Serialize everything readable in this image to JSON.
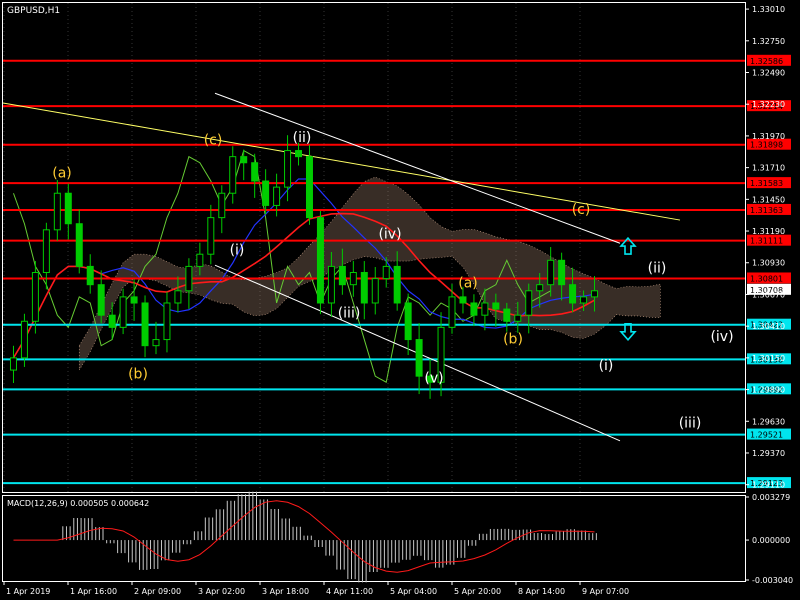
{
  "chart_data": {
    "type": "candlestick",
    "symbol": "GBPUSD",
    "timeframe": "H1",
    "title": "GBPUSD,H1",
    "price_range": [
      1.2905,
      1.3306
    ],
    "price_ticks": [
      "1.33010",
      "1.32750",
      "1.32490",
      "1.32230",
      "1.31970",
      "1.31710",
      "1.31450",
      "1.31190",
      "1.30930",
      "1.30670",
      "1.30410",
      "1.30150",
      "1.29890",
      "1.29630",
      "1.29370",
      "1.29110"
    ],
    "time_labels": [
      "1 Apr 2019",
      "1 Apr 16:00",
      "2 Apr 09:00",
      "3 Apr 02:00",
      "3 Apr 18:00",
      "4 Apr 11:00",
      "5 Apr 04:00",
      "5 Apr 20:00",
      "8 Apr 14:00",
      "9 Apr 07:00"
    ],
    "levels": [
      {
        "value": 1.32586,
        "label": "1.32586",
        "color": "#ff0000"
      },
      {
        "value": 1.32214,
        "label": "1.32214",
        "color": "#ff0000"
      },
      {
        "value": 1.31898,
        "label": "1.31898",
        "color": "#ff0000"
      },
      {
        "value": 1.31583,
        "label": "1.31583",
        "color": "#ff0000"
      },
      {
        "value": 1.31363,
        "label": "1.31363",
        "color": "#ff0000"
      },
      {
        "value": 1.31111,
        "label": "1.31111",
        "color": "#ff0000"
      },
      {
        "value": 1.30801,
        "label": "1.30801",
        "color": "#ff0000"
      },
      {
        "value": 1.30422,
        "label": "1.30422",
        "color": "#00e5ee"
      },
      {
        "value": 1.30138,
        "label": "1.30138",
        "color": "#00e5ee"
      },
      {
        "value": 1.29892,
        "label": "1.29892",
        "color": "#00e5ee"
      },
      {
        "value": 1.29521,
        "label": "1.29521",
        "color": "#00e5ee"
      },
      {
        "value": 1.29123,
        "label": "1.29123",
        "color": "#00e5ee"
      }
    ],
    "current_price": {
      "value": 1.30708,
      "label": "1.30708"
    },
    "close_series": [
      1.3015,
      1.3045,
      1.3085,
      1.312,
      1.315,
      1.3125,
      1.309,
      1.3075,
      1.305,
      1.304,
      1.3065,
      1.306,
      1.3025,
      1.303,
      1.306,
      1.307,
      1.309,
      1.31,
      1.313,
      1.315,
      1.318,
      1.3175,
      1.316,
      1.314,
      1.3155,
      1.3185,
      1.318,
      1.313,
      1.306,
      1.309,
      1.3075,
      1.3085,
      1.306,
      1.308,
      1.309,
      1.306,
      1.303,
      1.3,
      1.2995,
      1.304,
      1.3065,
      1.306,
      1.305,
      1.306,
      1.3055,
      1.3045,
      1.305,
      1.307,
      1.3075,
      1.3095,
      1.3075,
      1.306,
      1.3065,
      1.307
    ],
    "waves": [
      {
        "label": "(a)",
        "price": 1.3167,
        "color": "#ffcc33"
      },
      {
        "label": "(b)",
        "price": 1.3002,
        "color": "#ffcc33"
      },
      {
        "label": "(c)",
        "price": 1.3194,
        "color": "#ffcc33"
      },
      {
        "label": "(ii)",
        "price": 1.3196,
        "color": "#ffffff"
      },
      {
        "label": "(i)",
        "price": 1.3104,
        "color": "#ffffff"
      },
      {
        "label": "(iv)",
        "price": 1.3117,
        "color": "#ffffff"
      },
      {
        "label": "(iii)",
        "price": 1.3052,
        "color": "#ffffff"
      },
      {
        "label": "(v)",
        "price": 1.2999,
        "color": "#ffffff"
      },
      {
        "label": "(a)",
        "price": 1.3077,
        "color": "#ffcc33"
      },
      {
        "label": "(b)",
        "price": 1.3031,
        "color": "#ffcc33"
      },
      {
        "label": "(c)",
        "price": 1.3137,
        "color": "#ffcc33"
      },
      {
        "label": "(ii)",
        "price": 1.3089,
        "color": "#ffffff"
      },
      {
        "label": "(iv)",
        "price": 1.3033,
        "color": "#ffffff"
      },
      {
        "label": "(i)",
        "price": 1.3009,
        "color": "#ffffff"
      },
      {
        "label": "(iii)",
        "price": 1.2962,
        "color": "#ffffff"
      }
    ],
    "macd": {
      "label": "MACD(12,26,9) 0.000505 0.000642",
      "params": "12,26,9",
      "value": 0.000505,
      "signal": 0.000642,
      "ticks": [
        "0.003279",
        "0.000000",
        "-0.003040"
      ],
      "range": [
        -0.00304,
        0.003279
      ]
    }
  }
}
